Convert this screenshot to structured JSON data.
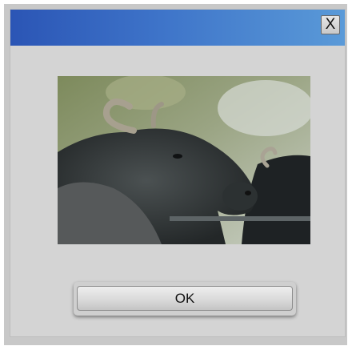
{
  "dialog": {
    "close_label": "X",
    "ok_label": "OK",
    "image_subject": "water-buffalo-photo"
  },
  "colors": {
    "titlebar_start": "#2b55b5",
    "titlebar_end": "#5a9ad8",
    "dialog_bg": "#d4d4d4"
  }
}
